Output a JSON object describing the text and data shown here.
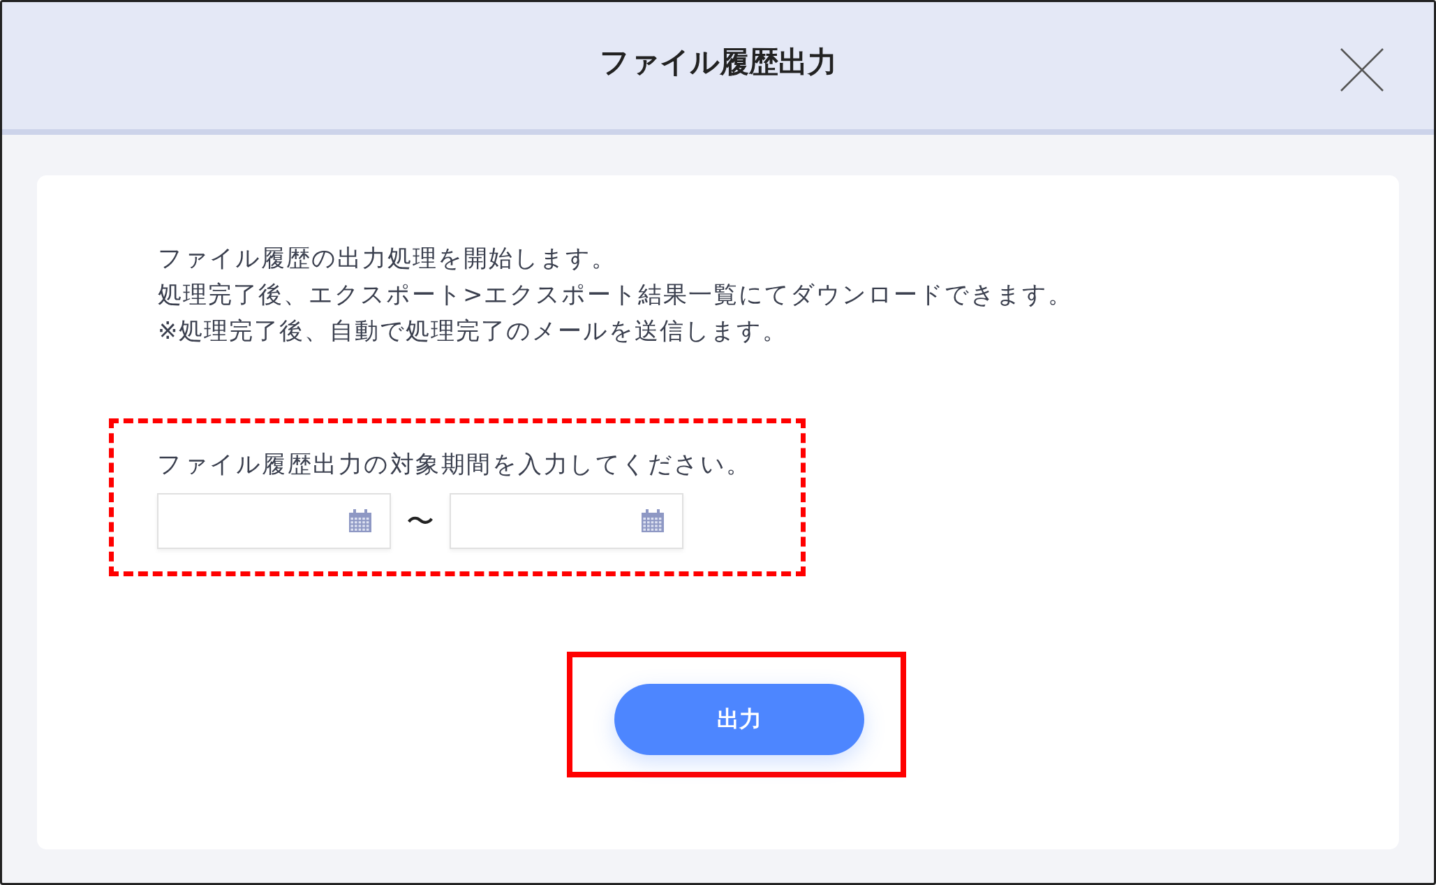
{
  "dialog": {
    "title": "ファイル履歴出力"
  },
  "message_lines": [
    "ファイル履歴の出力処理を開始します。",
    "処理完了後、エクスポート>エクスポート結果一覧にてダウンロードできます。",
    "※処理完了後、自動で処理完了のメールを送信します。"
  ],
  "period": {
    "highlight": {
      "kind": "dashed"
    },
    "label": "ファイル履歴出力の対象期間を入力してください。",
    "separator": "〜",
    "fields": [
      {
        "kind": "date"
      },
      {
        "kind": "date"
      }
    ]
  },
  "submit": {
    "label": "出力",
    "highlight": {
      "kind": "solid"
    }
  }
}
